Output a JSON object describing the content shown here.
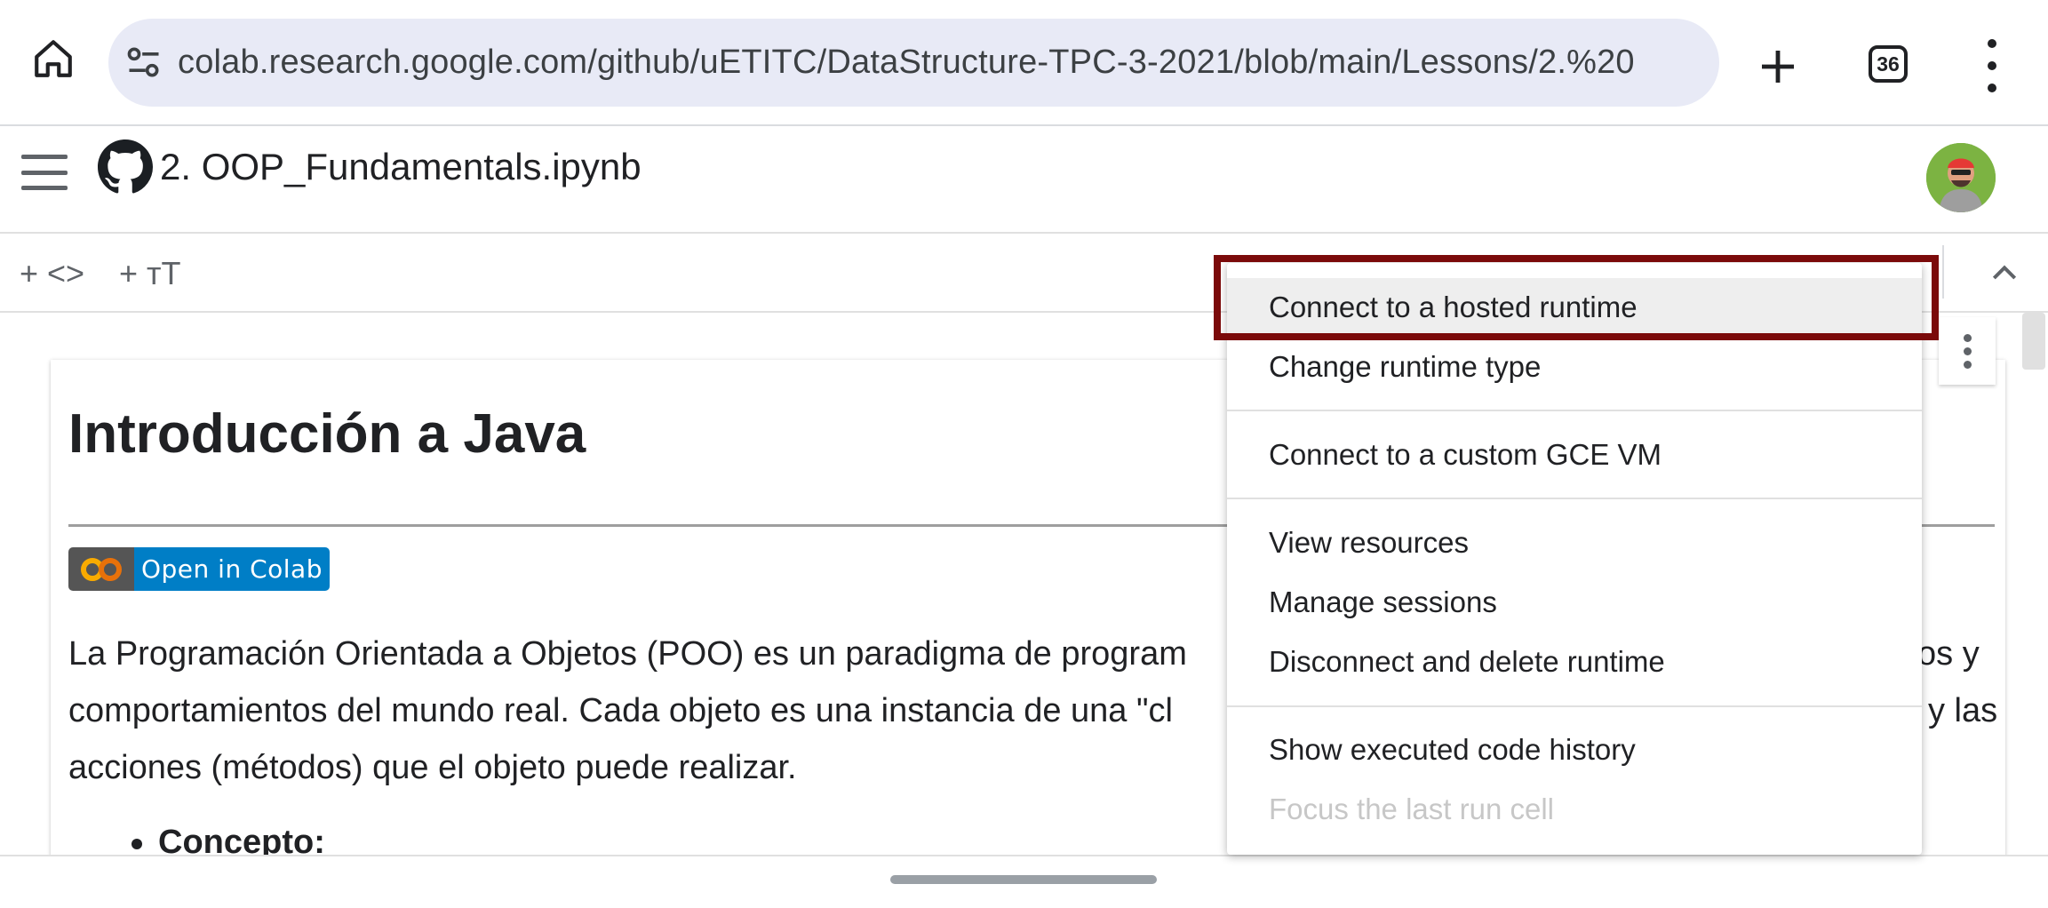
{
  "browser": {
    "url": "colab.research.google.com/github/uETITC/DataStructure-TPC-3-2021/blob/main/Lessons/2.%20",
    "tab_count": "36"
  },
  "header": {
    "notebook_title": "2. OOP_Fundamentals.ipynb"
  },
  "toolbar": {
    "add_code_label": "+ <>",
    "add_text_label": "+ ᴛT"
  },
  "notebook": {
    "heading": "Introducción a Java",
    "badge_label": "Open in Colab",
    "paragraph_lines": [
      "La Programación Orientada a Objetos (POO) es un paradigma de program",
      "comportamientos del mundo real. Cada objeto es una instancia de una \"cl",
      "acciones (métodos) que el objeto puede realizar."
    ],
    "paragraph_right_fragments": [
      "os y",
      "y las"
    ],
    "bullet_label": "Concepto:"
  },
  "runtime_menu": {
    "items": [
      {
        "label": "Connect to a hosted runtime",
        "highlighted": true,
        "enabled": true
      },
      {
        "label": "Change runtime type",
        "enabled": true
      },
      {
        "label": "Connect to a custom GCE VM",
        "enabled": true
      },
      {
        "label": "View resources",
        "enabled": true
      },
      {
        "label": "Manage sessions",
        "enabled": true
      },
      {
        "label": "Disconnect and delete runtime",
        "enabled": true
      },
      {
        "label": "Show executed code history",
        "enabled": true
      },
      {
        "label": "Focus the last run cell",
        "enabled": false
      }
    ]
  },
  "colors": {
    "highlight_border": "#7b0a0a",
    "badge_blue": "#007ec6",
    "badge_gray": "#555555",
    "colab_orange": "#f9ab00"
  },
  "icons": [
    "home-icon",
    "tune-icon",
    "plus-icon",
    "tab-switcher-icon",
    "more-vert-icon",
    "hamburger-icon",
    "github-icon",
    "avatar",
    "chevron-up-icon",
    "colab-logo-icon"
  ]
}
